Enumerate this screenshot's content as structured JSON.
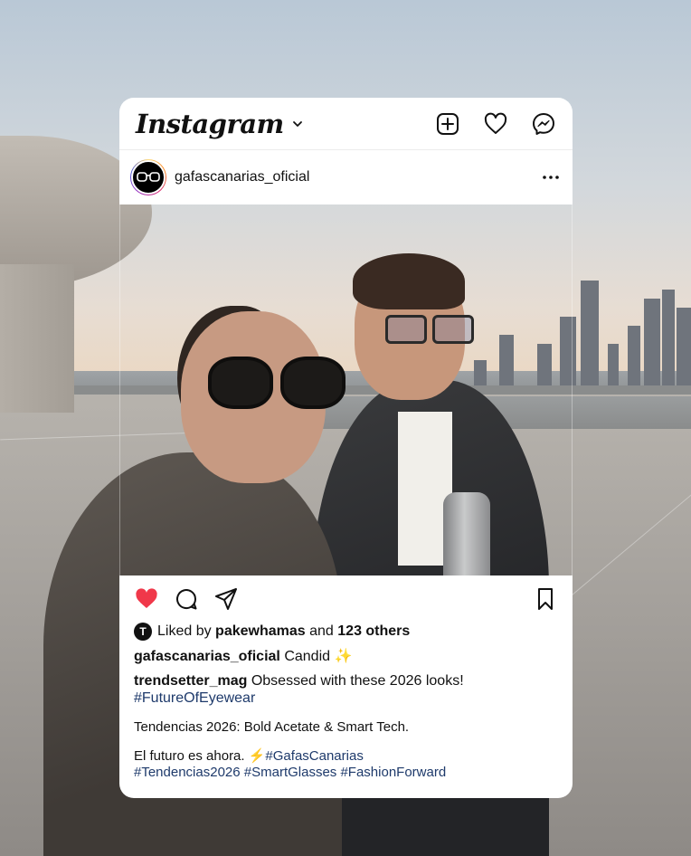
{
  "app": {
    "name": "Instagram"
  },
  "post": {
    "username": "gafascanarias_oficial",
    "likes": {
      "prefix": "Liked by",
      "liker": "pakewhamas",
      "middle": "and",
      "others": "123 others"
    },
    "caption": {
      "username": "gafascanarias_oficial",
      "text": "Candid ✨"
    },
    "comment": {
      "username": "trendsetter_mag",
      "text": "Obsessed with these 2026 looks!",
      "hashtag": "#FutureOfEyewear"
    },
    "body": {
      "line1": "Tendencias 2026: Bold Acetate & Smart Tech.",
      "line2_text": "El futuro es ahora. ⚡",
      "line2_tag": "#GafasCanarias",
      "tags": "#Tendencias2026 #SmartGlasses #FashionForward"
    }
  },
  "icons": {
    "header": [
      "chevron-down-icon",
      "new-post-icon",
      "heart-icon",
      "messenger-icon"
    ],
    "actions": [
      "heart-filled-icon",
      "comment-icon",
      "share-icon",
      "bookmark-icon"
    ]
  },
  "colors": {
    "like_red": "#f0384a",
    "hashtag": "#1e3a6b"
  },
  "like_avatar_glyph": "T"
}
